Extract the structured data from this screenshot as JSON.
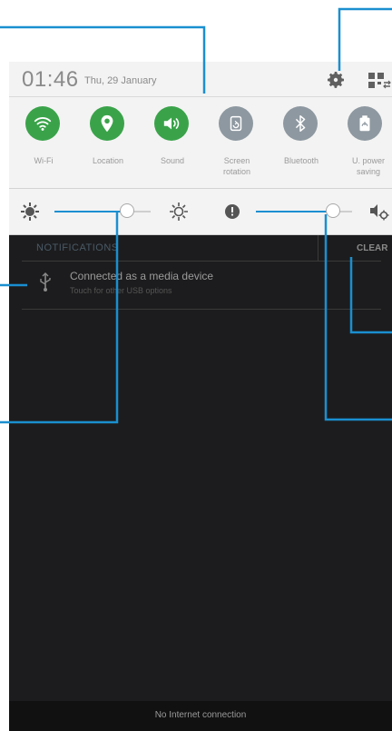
{
  "status": {
    "time": "01:46",
    "date": "Thu, 29 January",
    "settings_icon": "gear-icon",
    "toggle_icon": "grid-toggle-icon"
  },
  "quick_settings": [
    {
      "label": "Wi-Fi",
      "icon": "wifi-icon",
      "state": "on"
    },
    {
      "label": "Location",
      "icon": "location-pin-icon",
      "state": "on"
    },
    {
      "label": "Sound",
      "icon": "speaker-icon",
      "state": "on"
    },
    {
      "label": "Screen rotation",
      "icon": "rotate-icon",
      "state": "off"
    },
    {
      "label": "Bluetooth",
      "icon": "bluetooth-icon",
      "state": "off"
    },
    {
      "label": "U. power saving",
      "icon": "power-saving-icon",
      "state": "off"
    }
  ],
  "sliders": {
    "brightness_level": 0.75,
    "volume_level": 0.8
  },
  "notifications": {
    "header": "NOTIFICATIONS",
    "clear_label": "CLEAR",
    "items": [
      {
        "title": "Connected as a media device",
        "subtitle": "Touch for other USB options",
        "icon": "usb-icon"
      }
    ]
  },
  "bottom_bar": {
    "text": "No Internet connection"
  },
  "colors": {
    "accent": "#1a8fd0",
    "toggle_on": "#3aa34a",
    "toggle_off": "#8e98a0",
    "panel": "#f3f3f3",
    "shade": "#1c1c1e"
  }
}
